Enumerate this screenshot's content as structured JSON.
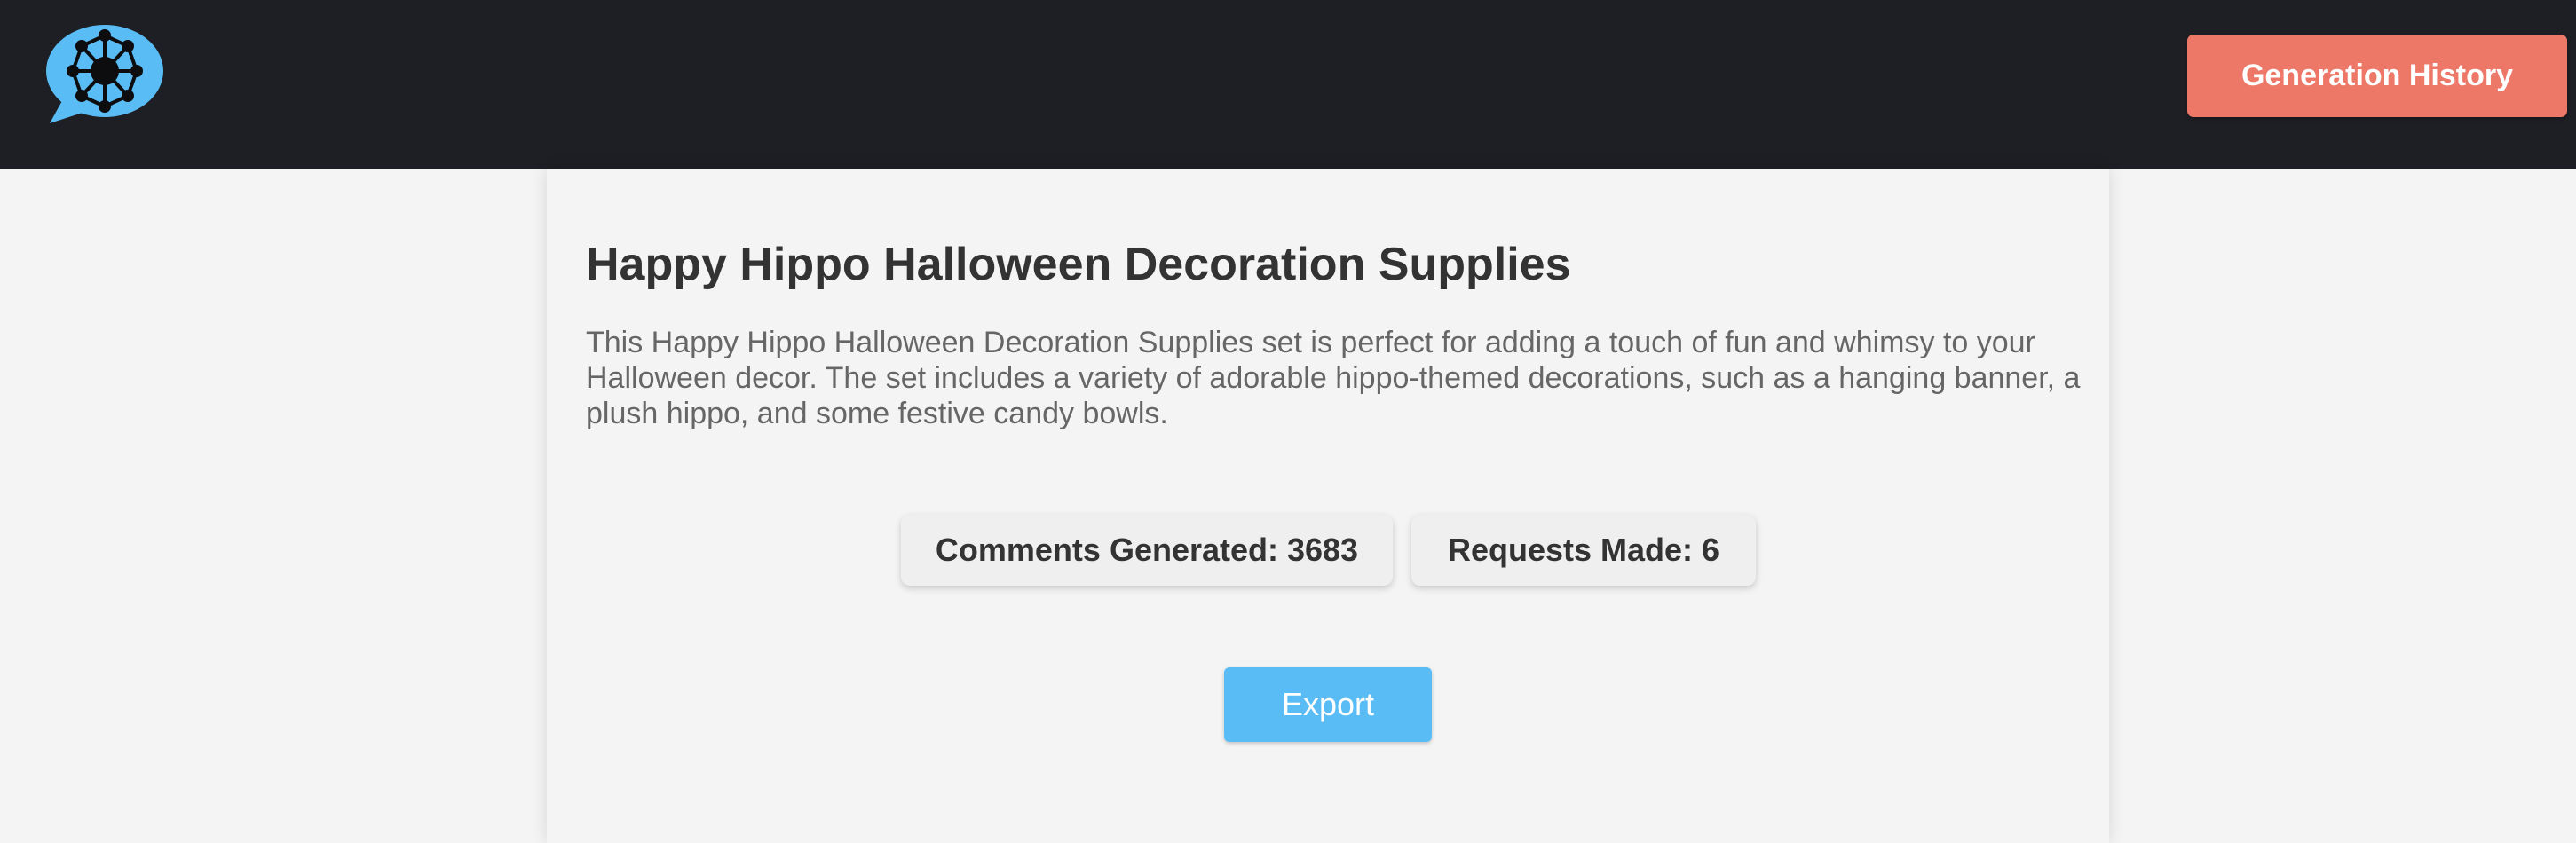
{
  "header": {
    "logo_icon": "chat-bubble-network-icon",
    "history_button_label": "Generation History"
  },
  "product": {
    "title": "Happy Hippo Halloween Decoration Supplies",
    "description": "This Happy Hippo Halloween Decoration Supplies set is perfect for adding a touch of fun and whimsy to your Halloween decor. The set includes a variety of adorable hippo-themed decorations, such as a hanging banner, a plush hippo, and some festive candy bowls."
  },
  "stats": {
    "comments_label": "Comments Generated: 3683",
    "requests_label": "Requests Made: 6"
  },
  "actions": {
    "export_label": "Export"
  },
  "colors": {
    "header_bg": "#1e1f24",
    "page_bg": "#f4f4f4",
    "history_button": "#ee7868",
    "export_button": "#5abcf4",
    "logo_bubble": "#5abcf4"
  }
}
